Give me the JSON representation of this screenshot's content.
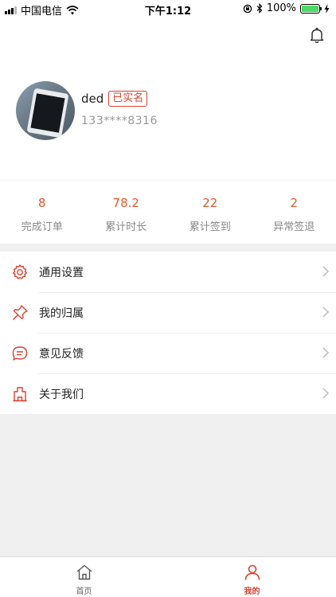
{
  "status_bar": {
    "carrier": "中国电信",
    "time": "下午1:12",
    "battery": "100%"
  },
  "profile": {
    "name": "ded",
    "verified_badge": "已实名",
    "phone": "133****8316"
  },
  "stats": [
    {
      "value": "8",
      "label": "完成订单"
    },
    {
      "value": "78.2",
      "label": "累计时长"
    },
    {
      "value": "22",
      "label": "累计签到"
    },
    {
      "value": "2",
      "label": "异常签退"
    }
  ],
  "menu": [
    {
      "label": "通用设置",
      "icon": "gear-icon"
    },
    {
      "label": "我的归属",
      "icon": "pin-icon"
    },
    {
      "label": "意见反馈",
      "icon": "feedback-icon"
    },
    {
      "label": "关于我们",
      "icon": "building-icon"
    }
  ],
  "tabbar": {
    "tabs": [
      {
        "label": "首页",
        "icon": "home-icon"
      },
      {
        "label": "我的",
        "icon": "person-icon"
      }
    ],
    "active_index": 1
  },
  "colors": {
    "accent": "#d9432f",
    "stat_value": "#e2572b",
    "background": "#f0f0f0"
  }
}
